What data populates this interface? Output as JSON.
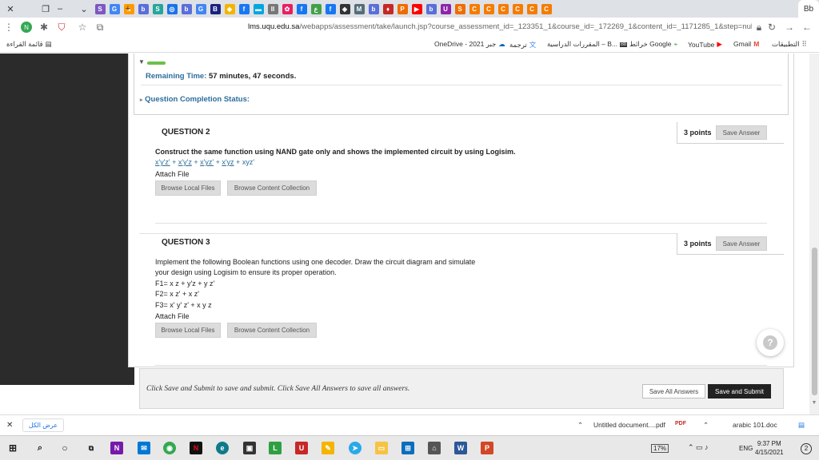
{
  "browser": {
    "url_host": "lms.uqu.edu.sa",
    "url_path": "/webapps/assessment/take/launch.jsp?course_assessment_id=_123351_1&course_id=_172269_1&content_id=_1171285_1&step=null",
    "active_tab_label": "Bb",
    "reading_list_label": "قائمة القراءة",
    "bookmarks": [
      {
        "label": "التطبيقات",
        "icon": "apps-grid-icon"
      },
      {
        "label": "Gmail",
        "icon": "gmail-icon"
      },
      {
        "label": "YouTube",
        "icon": "youtube-icon"
      },
      {
        "label": "خرائط Google",
        "icon": "maps-icon"
      },
      {
        "label": "المقررات الدراسية – B...",
        "icon": "blackboard-icon"
      },
      {
        "label": "ترجمة",
        "icon": "translate-icon"
      },
      {
        "label": "OneDrive - جبر 2021",
        "icon": "onedrive-icon"
      }
    ],
    "tab_chips": [
      {
        "glyph": "S",
        "color": "#7e57c2"
      },
      {
        "glyph": "G",
        "color": "#4285f4"
      },
      {
        "glyph": "a",
        "color": "#ff9900"
      },
      {
        "glyph": "b",
        "color": "#5a6fd8"
      },
      {
        "glyph": "S",
        "color": "#26a69a"
      },
      {
        "glyph": "◎",
        "color": "#1a73e8"
      },
      {
        "glyph": "b",
        "color": "#5a6fd8"
      },
      {
        "glyph": "G",
        "color": "#4285f4"
      },
      {
        "glyph": "B",
        "color": "#1a237e"
      },
      {
        "glyph": "◆",
        "color": "#f4b400"
      },
      {
        "glyph": "f",
        "color": "#1877f2"
      },
      {
        "glyph": "▬",
        "color": "#00a6e0"
      },
      {
        "glyph": "II",
        "color": "#777777"
      },
      {
        "glyph": "✿",
        "color": "#e91e63"
      },
      {
        "glyph": "f",
        "color": "#1877f2"
      },
      {
        "glyph": "ع",
        "color": "#43a047"
      },
      {
        "glyph": "f",
        "color": "#1877f2"
      },
      {
        "glyph": "◈",
        "color": "#333333"
      },
      {
        "glyph": "M",
        "color": "#546e7a"
      },
      {
        "glyph": "b",
        "color": "#5a6fd8"
      },
      {
        "glyph": "♦",
        "color": "#c62828"
      },
      {
        "glyph": "P",
        "color": "#ef6c00"
      },
      {
        "glyph": "▶",
        "color": "#ff0000"
      },
      {
        "glyph": "b",
        "color": "#5a6fd8"
      },
      {
        "glyph": "U",
        "color": "#8e24aa"
      },
      {
        "glyph": "S",
        "color": "#ef6c00"
      },
      {
        "glyph": "C",
        "color": "#f57c00"
      },
      {
        "glyph": "C",
        "color": "#f57c00"
      },
      {
        "glyph": "C",
        "color": "#f57c00"
      },
      {
        "glyph": "C",
        "color": "#f57c00"
      },
      {
        "glyph": "C",
        "color": "#f57c00"
      },
      {
        "glyph": "C",
        "color": "#f57c00"
      }
    ]
  },
  "status": {
    "remaining_label": "Remaining Time:",
    "remaining_minutes": "57",
    "minutes_word": "minutes,",
    "remaining_seconds": "47",
    "seconds_word": "seconds.",
    "completion_label": "Question Completion Status:"
  },
  "questions": [
    {
      "title": "QUESTION 2",
      "points": "3 points",
      "save_label": "Save Answer",
      "prompt": "Construct the same function using NAND gate only and shows the implemented circuit by using Logisim.",
      "formula_terms": [
        "x'y'z'",
        "x'y'z",
        "x'yz'",
        "x'yz",
        "xyz'"
      ],
      "attach_label": "Attach File",
      "browse_local": "Browse Local Files",
      "browse_collection": "Browse Content Collection"
    },
    {
      "title": "QUESTION 3",
      "points": "3 points",
      "save_label": "Save Answer",
      "lines": [
        "Implement the following Boolean functions using one decoder. Draw the circuit diagram and simulate",
        "your design using Logisim to ensure its proper operation.",
        "F1= x z + y'z + y z'",
        "F2= x z' + x z'",
        "F3= x' y' z' + x y z"
      ],
      "attach_label": "Attach File",
      "browse_local": "Browse Local Files",
      "browse_collection": "Browse Content Collection"
    }
  ],
  "submit": {
    "message": "Click Save and Submit to save and submit. Click Save All Answers to save all answers.",
    "save_all": "Save All Answers",
    "save_submit": "Save and Submit"
  },
  "downloads": {
    "show_all": "عرض الكل",
    "item1": "Untitled document....pdf",
    "item2": "arabic 101.doc"
  },
  "taskbar": {
    "battery": "17%",
    "lang": "ENG",
    "time": "9:37 PM",
    "date": "4/15/2021",
    "notif_count": "2"
  }
}
